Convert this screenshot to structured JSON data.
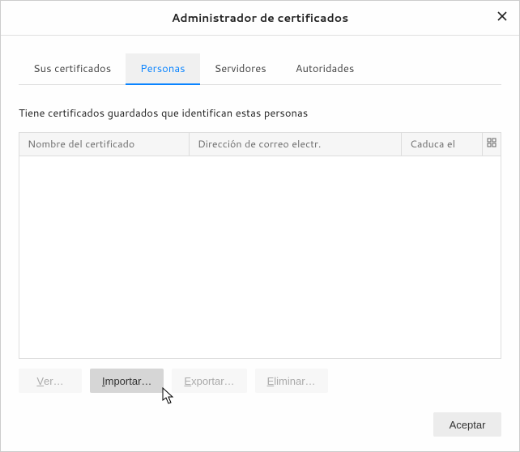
{
  "window": {
    "title": "Administrador de certificados"
  },
  "tabs": {
    "items": [
      {
        "label": "Sus certificados",
        "active": false
      },
      {
        "label": "Personas",
        "active": true
      },
      {
        "label": "Servidores",
        "active": false
      },
      {
        "label": "Autoridades",
        "active": false
      }
    ]
  },
  "description": "Tiene certificados guardados que identifican estas personas",
  "columns": {
    "name": "Nombre del certificado",
    "email": "Dirección de correo electr.",
    "expires": "Caduca el"
  },
  "rows": [],
  "actions": {
    "view": {
      "accel": "V",
      "rest": "er…",
      "enabled": false
    },
    "import": {
      "accel": "I",
      "rest": "mportar…",
      "enabled": true,
      "hovered": true
    },
    "export": {
      "accel": "E",
      "rest": "xportar…",
      "enabled": false
    },
    "delete": {
      "accel": "E",
      "rest": "liminar…",
      "enabled": false
    }
  },
  "footer": {
    "accept": "Aceptar"
  }
}
